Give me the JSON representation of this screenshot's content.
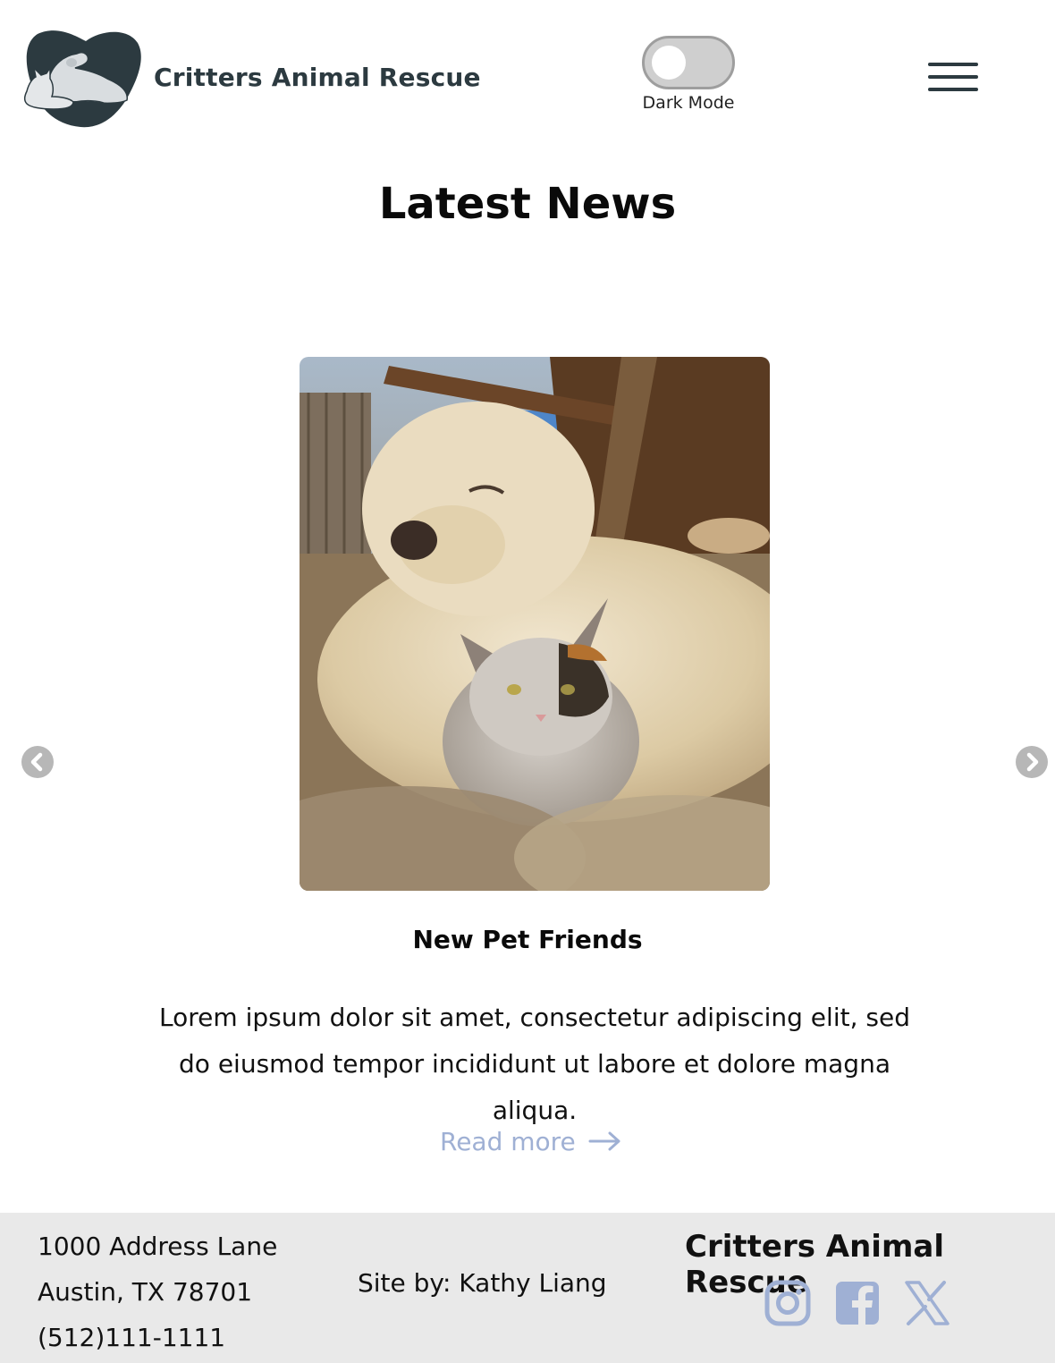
{
  "header": {
    "brand": "Critters Animal Rescue",
    "toggle_label": "Dark Mode",
    "toggle_state": "off",
    "menu_icon": "hamburger-menu-icon",
    "logo_icon": "dog-and-cat-logo"
  },
  "main": {
    "title": "Latest News",
    "card": {
      "image_subject": "fluffy cream dog lying with a calico kitten",
      "title": "New Pet Friends",
      "text": "Lorem ipsum dolor sit amet, consectetur adipiscing elit, sed do eiusmod tempor incididunt ut labore et dolore magna aliqua.",
      "read_more": "Read more"
    },
    "carousel": {
      "prev_icon": "chevron-left-circle-icon",
      "next_icon": "chevron-right-circle-icon"
    }
  },
  "footer": {
    "address_line1": "1000 Address Lane",
    "address_line2": "Austin, TX 78701",
    "phone": "(512)111-1111",
    "site_by": "Site by: Kathy Liang",
    "brand": "Critters Animal Rescue",
    "socials": [
      "instagram-icon",
      "facebook-icon",
      "x-icon"
    ]
  },
  "colors": {
    "brand_text": "#2c3a40",
    "link": "#9fb0d4",
    "footer_bg": "#e9e9e9",
    "toggle_bg": "#cfcfcf",
    "social_icon": "#9fb0d4"
  }
}
